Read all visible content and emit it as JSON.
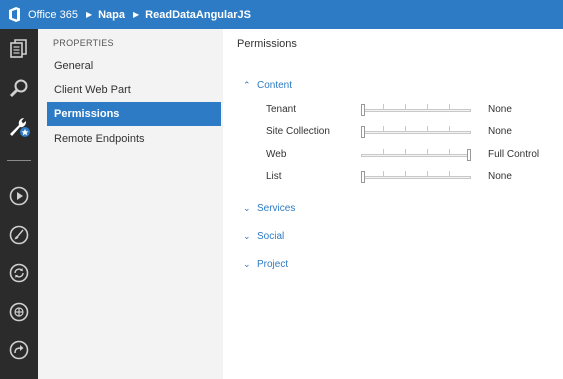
{
  "topbar": {
    "brand": "Office 365",
    "crumb1": "Napa",
    "crumb2": "ReadDataAngularJS"
  },
  "rail": {
    "icons": [
      "documents-icon",
      "search-icon",
      "settings-wrench-icon",
      "play-icon",
      "brush-icon",
      "refresh-icon",
      "publish-icon",
      "share-icon"
    ]
  },
  "sidebar": {
    "heading": "PROPERTIES",
    "items": [
      {
        "label": "General"
      },
      {
        "label": "Client Web Part"
      },
      {
        "label": "Permissions",
        "active": true
      },
      {
        "label": "Remote Endpoints"
      }
    ]
  },
  "main": {
    "title": "Permissions",
    "sections": [
      {
        "name": "Content",
        "expanded": true
      },
      {
        "name": "Services",
        "expanded": false
      },
      {
        "name": "Social",
        "expanded": false
      },
      {
        "name": "Project",
        "expanded": false
      }
    ],
    "permissions": [
      {
        "label": "Tenant",
        "value": "None",
        "level": 0
      },
      {
        "label": "Site Collection",
        "value": "None",
        "level": 0
      },
      {
        "label": "Web",
        "value": "Full Control",
        "level": 1
      },
      {
        "label": "List",
        "value": "None",
        "level": 0
      }
    ]
  },
  "colors": {
    "accent": "#2d7bc4",
    "rail": "#2b2b2b",
    "sidebar_bg": "#f3f3f3"
  }
}
